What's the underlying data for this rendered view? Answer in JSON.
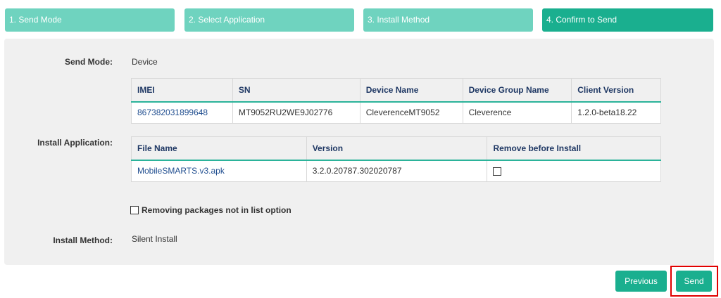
{
  "steps": [
    {
      "label": "1. Send Mode"
    },
    {
      "label": "2. Select Application"
    },
    {
      "label": "3. Install Method"
    },
    {
      "label": "4. Confirm to Send"
    }
  ],
  "send_mode": {
    "label": "Send Mode:",
    "value": "Device"
  },
  "device_table": {
    "headers": [
      "IMEI",
      "SN",
      "Device Name",
      "Device Group Name",
      "Client Version"
    ],
    "row": [
      "867382031899648",
      "MT9052RU2WE9J02776",
      "CleverenceMT9052",
      "Cleverence",
      "1.2.0-beta18.22"
    ]
  },
  "install_application": {
    "label": "Install Application:"
  },
  "app_table": {
    "headers": [
      "File Name",
      "Version",
      "Remove before Install"
    ],
    "row": [
      "MobileSMARTS.v3.apk",
      "3.2.0.20787.302020787"
    ],
    "remove_checked": false
  },
  "remove_packages": {
    "label": "Removing packages not in list option",
    "checked": false
  },
  "install_method": {
    "label": "Install Method:",
    "value": "Silent Install"
  },
  "buttons": {
    "previous": "Previous",
    "send": "Send"
  },
  "colors": {
    "step": "#6fd3bf",
    "step_active": "#1aaf8f",
    "accent": "#1aaf8f",
    "highlight": "#e00000"
  }
}
